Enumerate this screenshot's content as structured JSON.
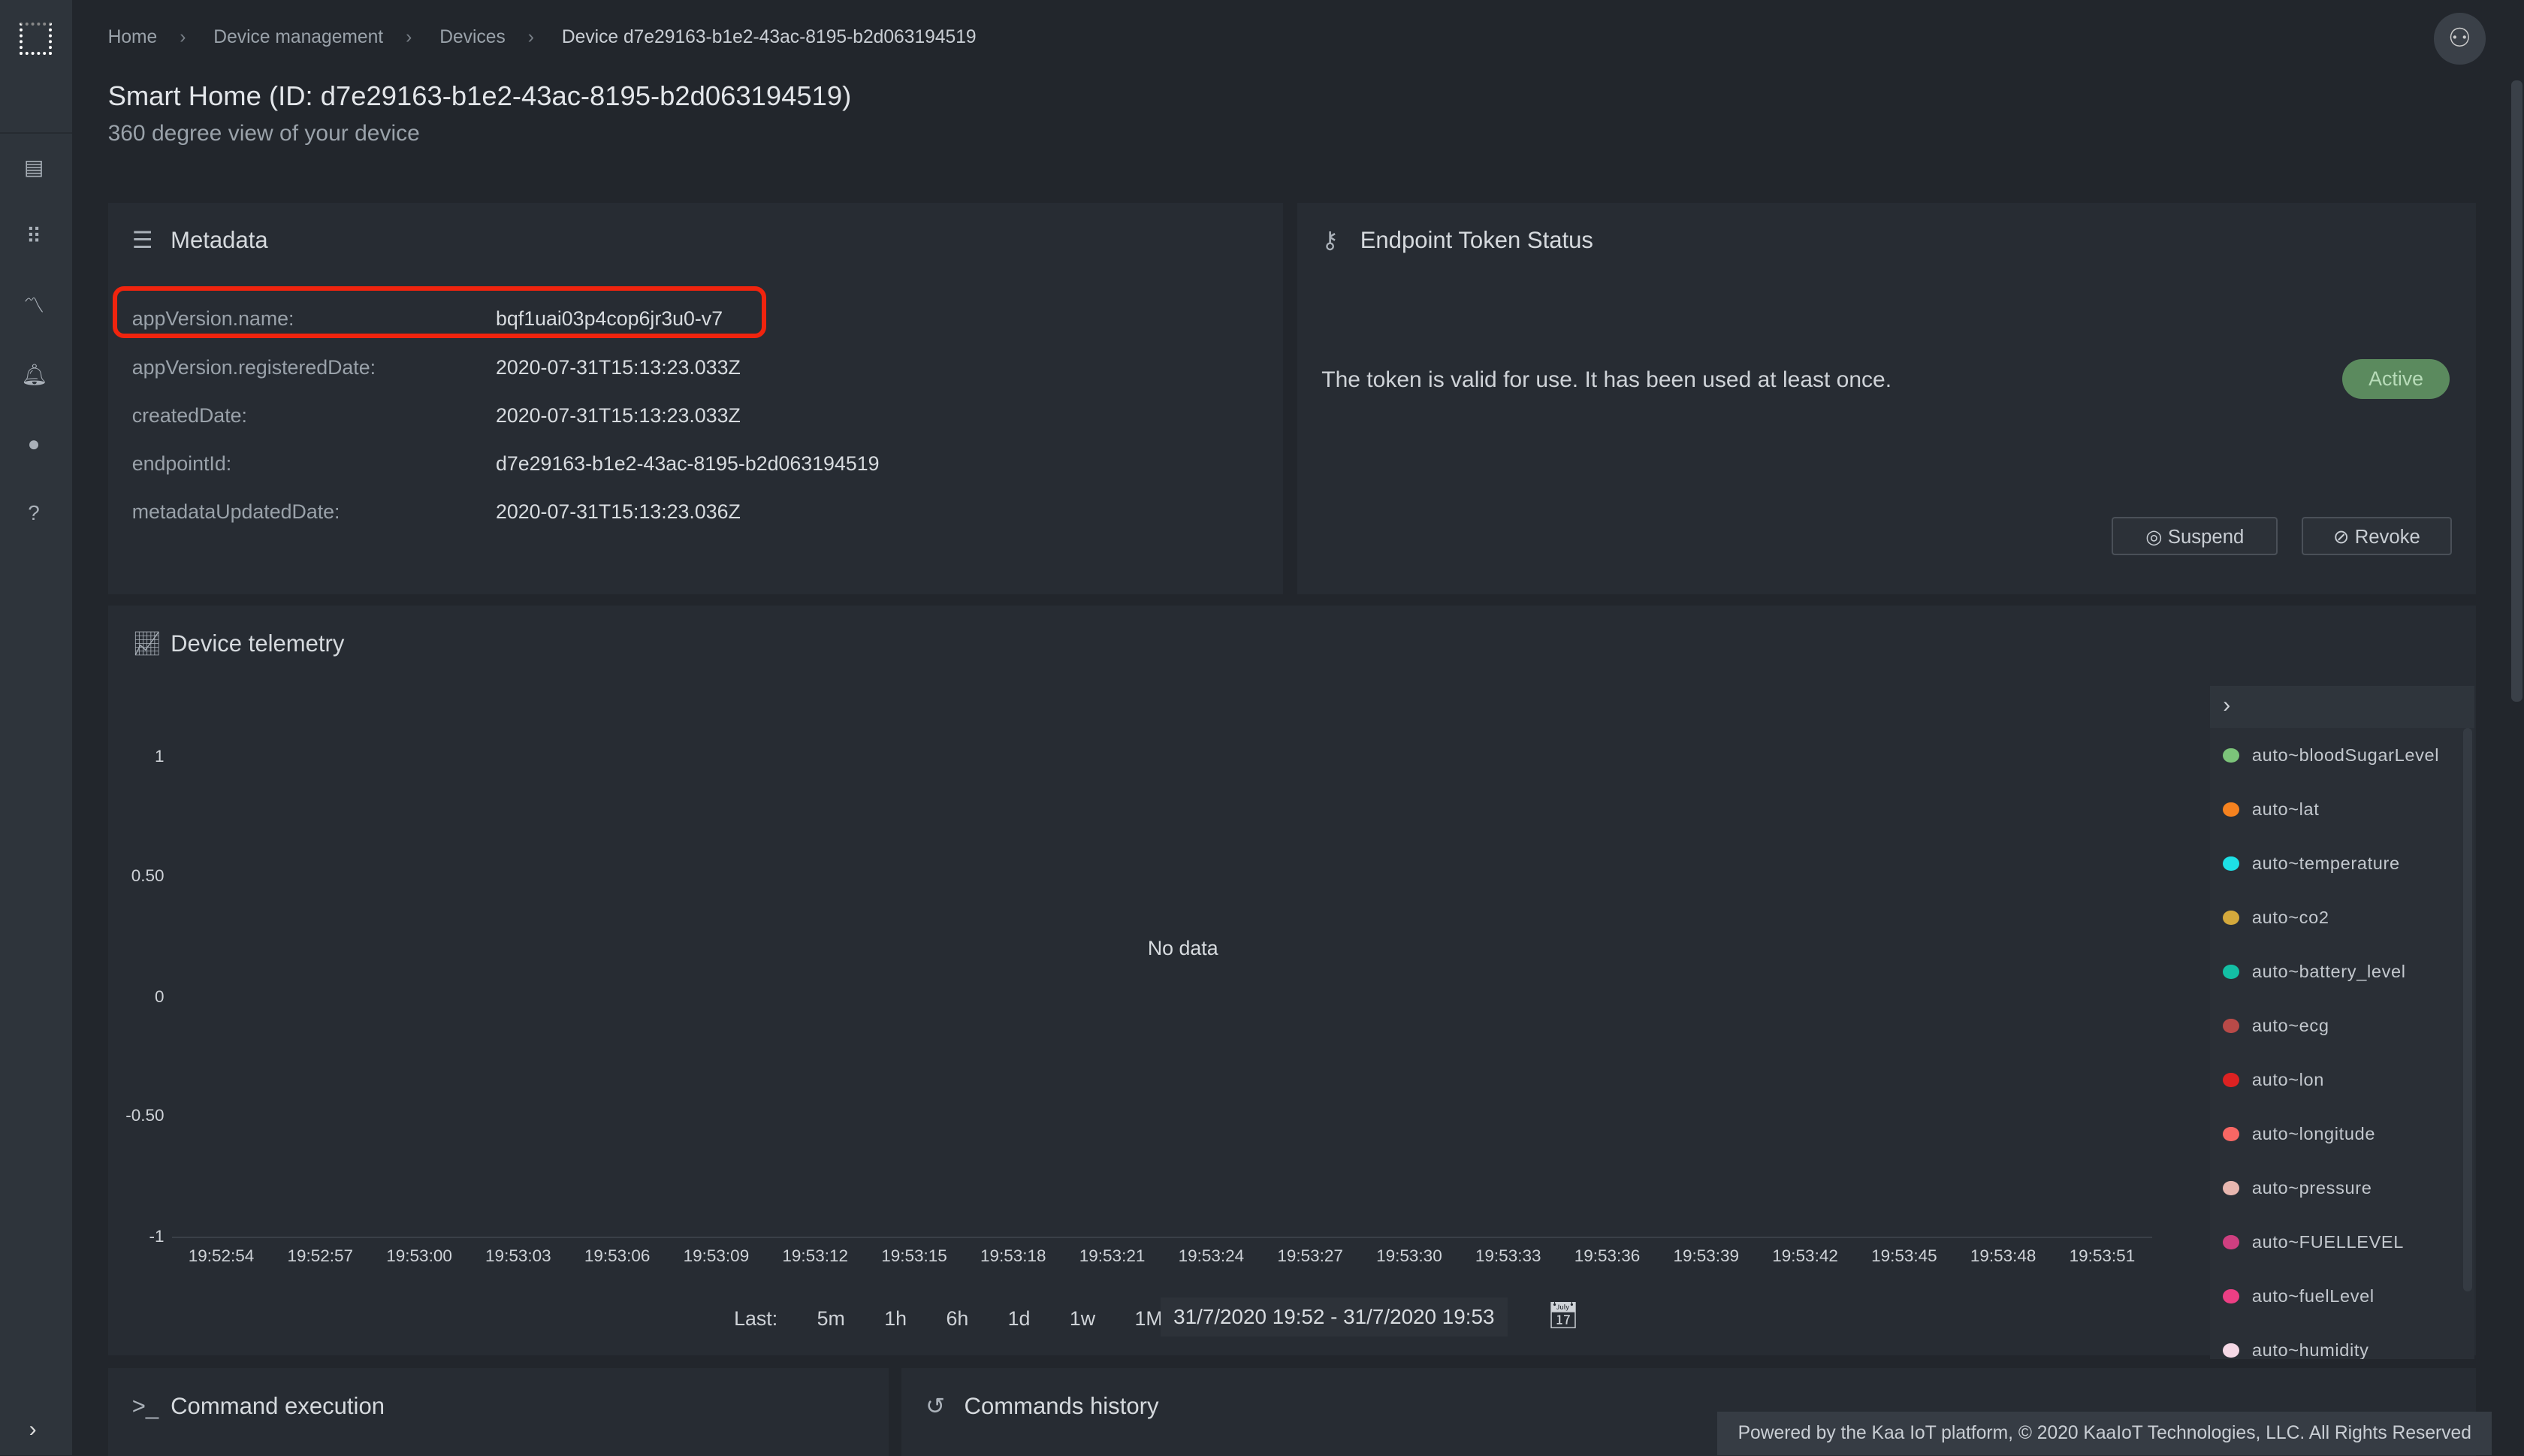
{
  "breadcrumb": [
    "Home",
    "Device management",
    "Devices",
    "Device d7e29163-b1e2-43ac-8195-b2d063194519"
  ],
  "page": {
    "title": "Smart Home (ID: d7e29163-b1e2-43ac-8195-b2d063194519)",
    "subtitle": "360 degree view of your device"
  },
  "metadata": {
    "title": "Metadata",
    "rows": [
      {
        "key": "appVersion.name:",
        "value": "bqf1uai03p4cop6jr3u0-v7"
      },
      {
        "key": "appVersion.registeredDate:",
        "value": "2020-07-31T15:13:23.033Z"
      },
      {
        "key": "createdDate:",
        "value": "2020-07-31T15:13:23.033Z"
      },
      {
        "key": "endpointId:",
        "value": "d7e29163-b1e2-43ac-8195-b2d063194519"
      },
      {
        "key": "metadataUpdatedDate:",
        "value": "2020-07-31T15:13:23.036Z"
      }
    ],
    "highlight_color": "#f0240e"
  },
  "token": {
    "title": "Endpoint Token Status",
    "message": "The token is valid for use. It has been used at least once.",
    "status": "Active",
    "status_color": "#5b8a5e",
    "suspend_label": "Suspend",
    "revoke_label": "Revoke"
  },
  "telemetry": {
    "title": "Device telemetry",
    "empty_text": "No data",
    "last_label": "Last:",
    "ranges": [
      "5m",
      "1h",
      "6h",
      "1d",
      "1w",
      "1M"
    ],
    "date_range": "31/7/2020 19:52 - 31/7/2020 19:53"
  },
  "chart_data": {
    "type": "line",
    "ylim": [
      -1,
      1
    ],
    "y_ticks": [
      "1",
      "0.50",
      "0",
      "-0.50",
      "-1"
    ],
    "x_ticks": [
      "19:52:54",
      "19:52:57",
      "19:53:00",
      "19:53:03",
      "19:53:06",
      "19:53:09",
      "19:53:12",
      "19:53:15",
      "19:53:18",
      "19:53:21",
      "19:53:24",
      "19:53:27",
      "19:53:30",
      "19:53:33",
      "19:53:36",
      "19:53:39",
      "19:53:42",
      "19:53:45",
      "19:53:48",
      "19:53:51"
    ],
    "legend_position": "right",
    "series": [
      {
        "name": "auto~bloodSugarLevel",
        "color": "#7cc47a",
        "values": []
      },
      {
        "name": "auto~lat",
        "color": "#f5821f",
        "values": []
      },
      {
        "name": "auto~temperature",
        "color": "#1de0e6",
        "values": []
      },
      {
        "name": "auto~co2",
        "color": "#d4a93c",
        "values": []
      },
      {
        "name": "auto~battery_level",
        "color": "#13bfa4",
        "values": []
      },
      {
        "name": "auto~ecg",
        "color": "#b94a48",
        "values": []
      },
      {
        "name": "auto~lon",
        "color": "#dd2222",
        "values": []
      },
      {
        "name": "auto~longitude",
        "color": "#f86764",
        "values": []
      },
      {
        "name": "auto~pressure",
        "color": "#e8b7b0",
        "values": []
      },
      {
        "name": "auto~FUELLEVEL",
        "color": "#cf3f80",
        "values": []
      },
      {
        "name": "auto~fuelLevel",
        "color": "#ec3f84",
        "values": []
      },
      {
        "name": "auto~humidity",
        "color": "#f5d9e6",
        "values": []
      }
    ]
  },
  "command_execution": {
    "title": "Command execution"
  },
  "commands_history": {
    "title": "Commands history"
  },
  "footer": "Powered by the Kaa IoT platform, © 2020 KaaIoT Technologies, LLC. All Rights Reserved"
}
